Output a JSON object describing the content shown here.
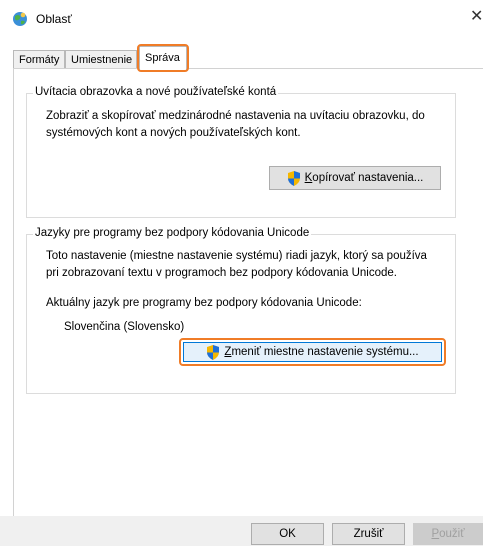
{
  "window": {
    "title": "Oblasť",
    "close_glyph": "✕"
  },
  "tabs": [
    {
      "label": "Formáty",
      "active": false
    },
    {
      "label": "Umiestnenie",
      "active": false
    },
    {
      "label": "Správa",
      "active": true
    }
  ],
  "welcome_group": {
    "title": "Uvítacia obrazovka a nové používateľské kontá",
    "line1": "Zobraziť a skopírovať medzinárodné nastavenia na uvítaciu obrazovku, do",
    "line2": "systémových kont a nových používateľských kont.",
    "copy_button_first": "K",
    "copy_button_rest": "opírovať nastavenia..."
  },
  "unicode_group": {
    "title": "Jazyky pre programy bez podpory kódovania Unicode",
    "line1": "Toto nastavenie (miestne nastavenie systému) riadi jazyk, ktorý sa používa",
    "line2": "pri zobrazovaní textu v programoch bez podpory kódovania Unicode.",
    "current_label": "Aktuálny jazyk pre programy bez podpory kódovania Unicode:",
    "current_value": "Slovenčina (Slovensko)",
    "change_button_first": "Z",
    "change_button_rest": "meniť miestne nastavenie systému..."
  },
  "footer": {
    "ok_label": "OK",
    "cancel_label": "Zrušiť",
    "apply_first": "P",
    "apply_rest": "oužiť"
  },
  "colors": {
    "highlight": "#f07c27",
    "accent": "#0078d7"
  }
}
